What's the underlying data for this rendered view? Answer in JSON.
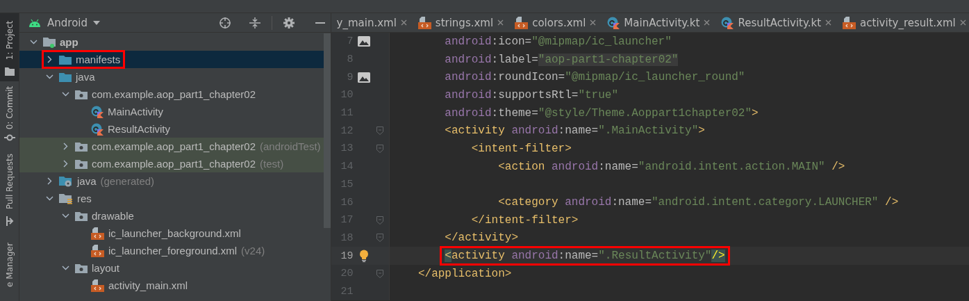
{
  "tool_strip": [
    {
      "label": "1: Project",
      "selected": true
    },
    {
      "label": "0: Commit",
      "selected": false
    },
    {
      "label": "Pull Requests",
      "selected": false
    },
    {
      "label": "e Manager",
      "selected": false
    }
  ],
  "project_panel": {
    "view": "Android",
    "tree": [
      {
        "label": "app",
        "kind": "module",
        "bold": true,
        "expanded": true,
        "children": [
          {
            "label": "manifests",
            "kind": "folder",
            "expanded": false,
            "selected": true,
            "annotated": true
          },
          {
            "label": "java",
            "kind": "folder",
            "expanded": true,
            "selected": false,
            "children": [
              {
                "label": "com.example.aop_part1_chapter02",
                "kind": "package",
                "expanded": true,
                "selected": false,
                "children": [
                  {
                    "label": "MainActivity",
                    "kind": "kotlin",
                    "selected": false
                  },
                  {
                    "label": "ResultActivity",
                    "kind": "kotlin",
                    "selected": false
                  }
                ]
              },
              {
                "label": "com.example.aop_part1_chapter02",
                "note": "(androidTest)",
                "kind": "test-package",
                "expanded": false,
                "selected": false
              },
              {
                "label": "com.example.aop_part1_chapter02",
                "note": "(test)",
                "kind": "test-package",
                "expanded": false,
                "selected": false
              }
            ]
          },
          {
            "label": "java",
            "note": "(generated)",
            "kind": "generated",
            "expanded": false,
            "selected": false
          },
          {
            "label": "res",
            "kind": "res",
            "expanded": true,
            "selected": false,
            "children": [
              {
                "label": "drawable",
                "kind": "package",
                "expanded": true,
                "selected": false,
                "children": [
                  {
                    "label": "ic_launcher_background.xml",
                    "kind": "xml",
                    "selected": false
                  },
                  {
                    "label": "ic_launcher_foreground.xml",
                    "note": "(v24)",
                    "kind": "xml",
                    "selected": false
                  }
                ]
              },
              {
                "label": "layout",
                "kind": "package",
                "expanded": true,
                "selected": false,
                "children": [
                  {
                    "label": "activity_main.xml",
                    "kind": "xml",
                    "selected": false
                  }
                ]
              }
            ]
          }
        ]
      }
    ]
  },
  "editor_tabs": [
    {
      "label": "y_main.xml",
      "kind": "plain"
    },
    {
      "label": "strings.xml",
      "kind": "xml"
    },
    {
      "label": "colors.xml",
      "kind": "xml"
    },
    {
      "label": "MainActivity.kt",
      "kind": "kotlin"
    },
    {
      "label": "ResultActivity.kt",
      "kind": "kotlin"
    },
    {
      "label": "activity_result.xml",
      "kind": "xml"
    }
  ],
  "code_lines": [
    {
      "number": "7",
      "kind": "image",
      "current": false,
      "annotated": false,
      "tokens": [
        {
          "kind": "ns",
          "text": "        android"
        },
        {
          "kind": "attr",
          "text": ":icon="
        },
        {
          "kind": "str",
          "text": "\"@mipmap/ic_launcher\""
        }
      ]
    },
    {
      "number": "8",
      "kind": "plain",
      "current": false,
      "annotated": false,
      "tokens": [
        {
          "kind": "ns",
          "text": "        android"
        },
        {
          "kind": "attr",
          "text": ":label="
        },
        {
          "kind": "str",
          "text": "\"aop-part1-chapter02\"",
          "highlighted": true
        }
      ]
    },
    {
      "number": "9",
      "kind": "image",
      "current": false,
      "annotated": false,
      "tokens": [
        {
          "kind": "ns",
          "text": "        android"
        },
        {
          "kind": "attr",
          "text": ":roundIcon="
        },
        {
          "kind": "str",
          "text": "\"@mipmap/ic_launcher_round\""
        }
      ]
    },
    {
      "number": "10",
      "kind": "plain",
      "current": false,
      "annotated": false,
      "tokens": [
        {
          "kind": "ns",
          "text": "        android"
        },
        {
          "kind": "attr",
          "text": ":supportsRtl="
        },
        {
          "kind": "str",
          "text": "\"true\""
        }
      ]
    },
    {
      "number": "11",
      "kind": "plain",
      "current": false,
      "annotated": false,
      "tokens": [
        {
          "kind": "ns",
          "text": "        android"
        },
        {
          "kind": "attr",
          "text": ":theme="
        },
        {
          "kind": "str",
          "text": "\"@style/Theme.Aoppart1chapter02\""
        },
        {
          "kind": "tag",
          "text": ">"
        }
      ]
    },
    {
      "number": "12",
      "kind": "fold",
      "current": false,
      "annotated": false,
      "tokens": [
        {
          "kind": "tag",
          "text": "        <activity "
        },
        {
          "kind": "ns",
          "text": "android"
        },
        {
          "kind": "attr",
          "text": ":name="
        },
        {
          "kind": "str",
          "text": "\".MainActivity\""
        },
        {
          "kind": "tag",
          "text": ">"
        }
      ]
    },
    {
      "number": "13",
      "kind": "fold",
      "current": false,
      "annotated": false,
      "tokens": [
        {
          "kind": "tag",
          "text": "            <intent-filter>"
        }
      ]
    },
    {
      "number": "14",
      "kind": "plain",
      "current": false,
      "annotated": false,
      "tokens": [
        {
          "kind": "tag",
          "text": "                <action "
        },
        {
          "kind": "ns",
          "text": "android"
        },
        {
          "kind": "attr",
          "text": ":name="
        },
        {
          "kind": "str",
          "text": "\"android.intent.action.MAIN\""
        },
        {
          "kind": "tag",
          "text": " />"
        }
      ]
    },
    {
      "number": "15",
      "kind": "plain",
      "current": false
    },
    {
      "number": "16",
      "kind": "plain",
      "current": false,
      "annotated": false,
      "tokens": [
        {
          "kind": "tag",
          "text": "                <category "
        },
        {
          "kind": "ns",
          "text": "android"
        },
        {
          "kind": "attr",
          "text": ":name="
        },
        {
          "kind": "str",
          "text": "\"android.intent.category.LAUNCHER\""
        },
        {
          "kind": "tag",
          "text": " />"
        }
      ]
    },
    {
      "number": "17",
      "kind": "fold",
      "current": false,
      "annotated": false,
      "tokens": [
        {
          "kind": "tag",
          "text": "            </intent-filter>"
        }
      ]
    },
    {
      "number": "18",
      "kind": "fold",
      "current": false,
      "annotated": false,
      "tokens": [
        {
          "kind": "tag",
          "text": "        </activity>"
        }
      ]
    },
    {
      "number": "19",
      "kind": "bulb",
      "current": true,
      "annotated": true,
      "tokens": [
        {
          "kind": "tag",
          "text": "        <",
          "highlighted": true
        },
        {
          "kind": "tag",
          "text": "activity "
        },
        {
          "kind": "ns",
          "text": "android"
        },
        {
          "kind": "attr",
          "text": ":name="
        },
        {
          "kind": "str",
          "text": "\".ResultActivity\""
        },
        {
          "kind": "match",
          "text": "/>",
          "highlighted": true
        }
      ]
    },
    {
      "number": "20",
      "kind": "fold",
      "current": false,
      "annotated": false,
      "tokens": [
        {
          "kind": "tag",
          "text": "    </application>"
        }
      ]
    },
    {
      "number": "21",
      "kind": "plain",
      "current": false
    }
  ]
}
